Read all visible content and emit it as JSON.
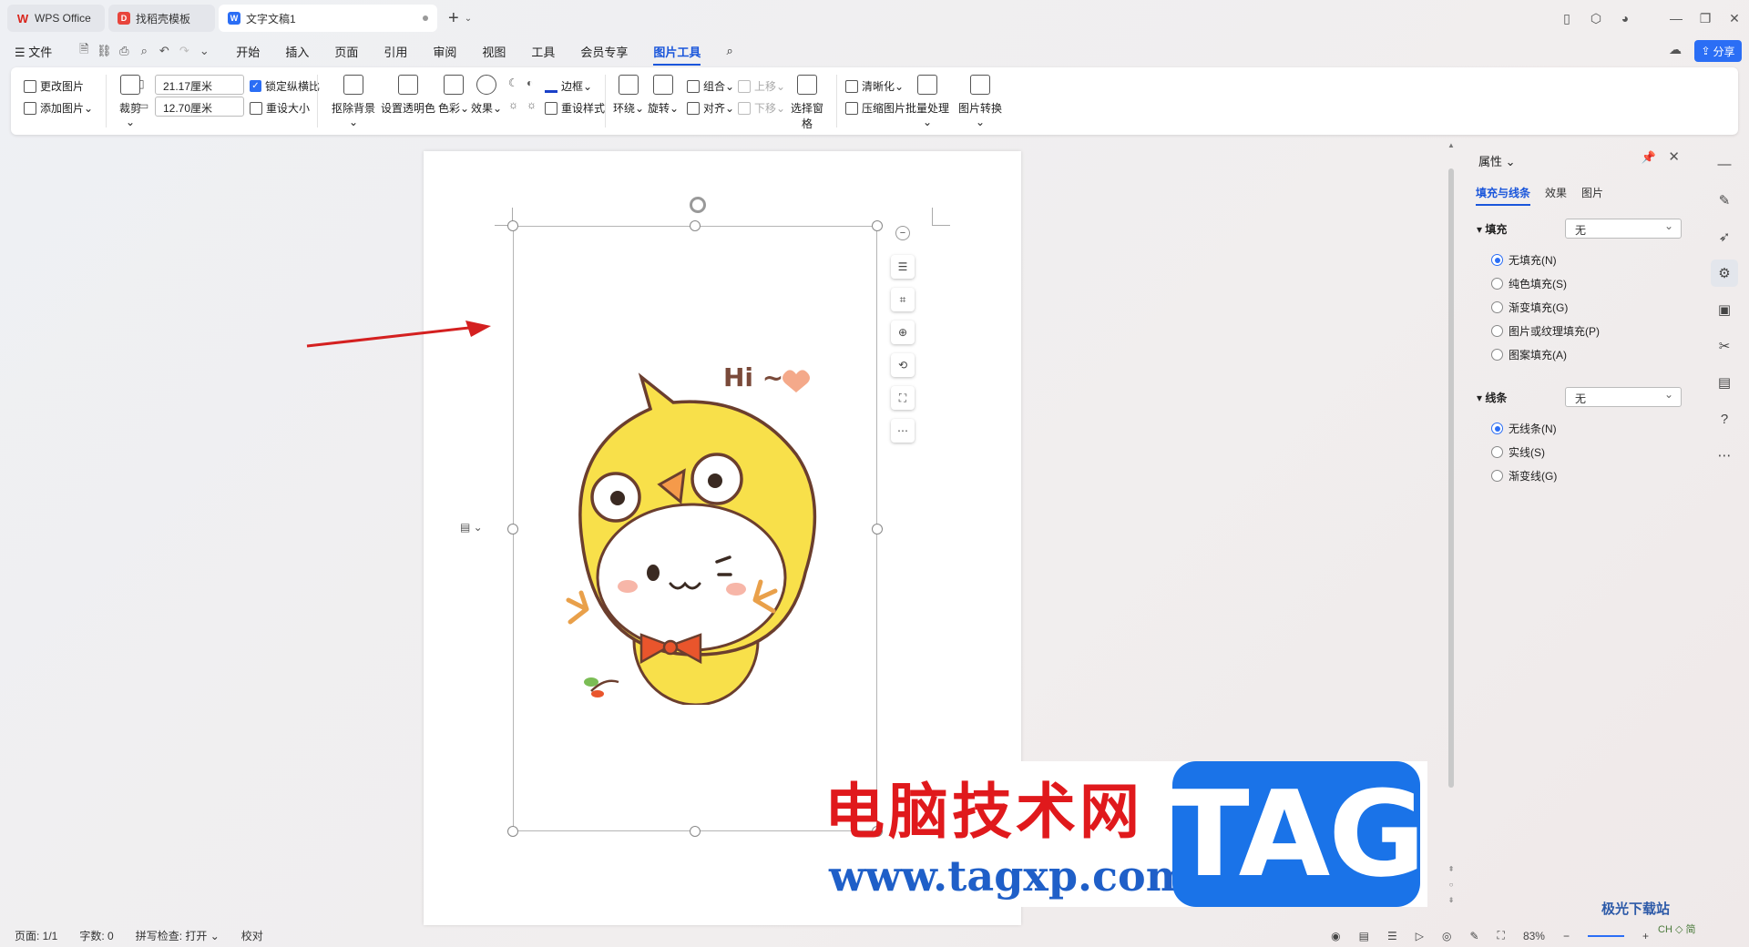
{
  "tabs": [
    {
      "label": "WPS Office"
    },
    {
      "label": "找稻壳模板"
    },
    {
      "label": "文字文稿1"
    }
  ],
  "menu": {
    "file": "文件",
    "items": [
      "开始",
      "插入",
      "页面",
      "引用",
      "审阅",
      "视图",
      "工具",
      "会员专享",
      "图片工具"
    ],
    "active": "图片工具",
    "share": "分享"
  },
  "ribbon": {
    "change_image": "更改图片",
    "add_image": "添加图片",
    "crop": "裁剪",
    "width_value": "21.17厘米",
    "height_value": "12.70厘米",
    "lock_ratio": "锁定纵横比",
    "reset_size": "重设大小",
    "remove_bg": "抠除背景",
    "set_transparent": "设置透明色",
    "color": "色彩",
    "effects": "效果",
    "border": "边框",
    "reset_style": "重设样式",
    "wrap": "环绕",
    "rotate": "旋转",
    "group": "组合",
    "align": "对齐",
    "move_up": "上移",
    "move_down": "下移",
    "selection_pane": "选择窗格",
    "sharpen": "清晰化",
    "compress": "压缩图片",
    "batch": "批量处理",
    "convert": "图片转换"
  },
  "image": {
    "text": "Hi ~"
  },
  "properties": {
    "title": "属性",
    "tabs": [
      "填充与线条",
      "效果",
      "图片"
    ],
    "fill_label": "填充",
    "fill_value": "无",
    "fill_options": [
      "无填充(N)",
      "纯色填充(S)",
      "渐变填充(G)",
      "图片或纹理填充(P)",
      "图案填充(A)"
    ],
    "line_label": "线条",
    "line_value": "无",
    "line_options": [
      "无线条(N)",
      "实线(S)",
      "渐变线(G)"
    ]
  },
  "status": {
    "page": "页面: 1/1",
    "words": "字数: 0",
    "spell": "拼写检查: 打开",
    "proof": "校对",
    "zoom": "83%"
  },
  "watermark": {
    "cn": "电脑技术网",
    "url": "www.tagxp.com",
    "tag": "TAG",
    "corner": "极光下载站",
    "corner2": "CH ◇ 简"
  },
  "colors": {
    "accent": "#2b6ef5",
    "arrow": "#d42020",
    "chick_yellow": "#f8e04a"
  }
}
